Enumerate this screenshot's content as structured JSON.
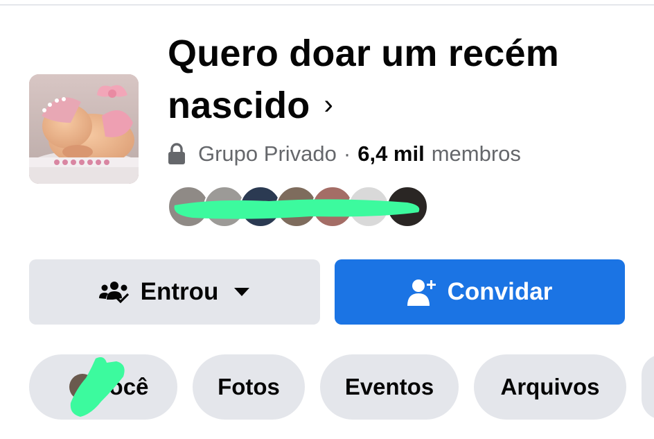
{
  "group": {
    "title_line1": "Quero doar um recém",
    "title_line2": "nascido",
    "privacy": "Grupo Privado",
    "separator": "·",
    "member_count": "6,4 mil",
    "member_label": "membros",
    "cover_icon": "baby-photo",
    "privacy_icon": "lock-icon",
    "title_chevron": "›"
  },
  "actions": {
    "joined_label": "Entrou",
    "invite_label": "Convidar"
  },
  "tabs": [
    {
      "label": "Você"
    },
    {
      "label": "Fotos"
    },
    {
      "label": "Eventos"
    },
    {
      "label": "Arquivos"
    }
  ],
  "colors": {
    "primary": "#1b74e4",
    "chip_bg": "#e4e6eb",
    "redaction": "#3cfa9e",
    "secondary_text": "#65676b"
  }
}
